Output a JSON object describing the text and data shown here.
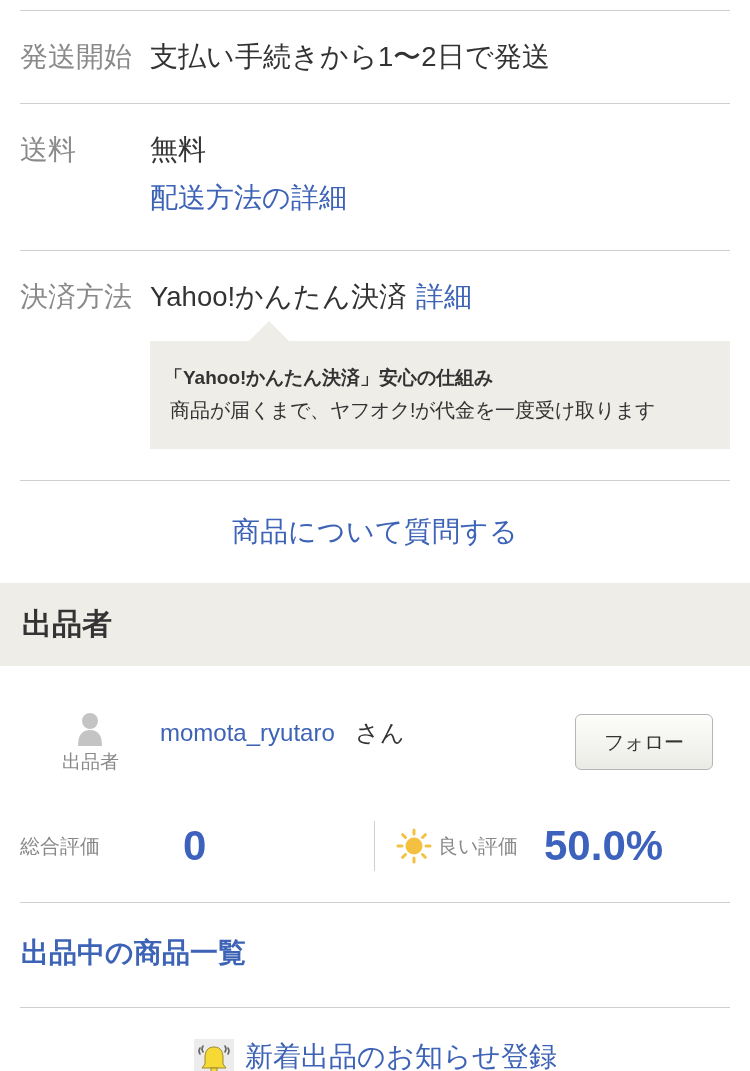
{
  "details": [
    {
      "kind": "plain",
      "label": "発送開始",
      "value": "支払い手続きから1〜2日で発送"
    },
    {
      "kind": "link_below",
      "label": "送料",
      "value": "無料",
      "link": "配送方法の詳細"
    },
    {
      "kind": "link_inline",
      "label": "決済方法",
      "value": "Yahoo!かんたん決済",
      "link": "詳細",
      "note": {
        "title": "「Yahoo!かんたん決済」安心の仕組み",
        "body": "商品が届くまで、ヤフオク!が代金を一度受け取ります"
      }
    }
  ],
  "question_link": "商品について質問する",
  "seller": {
    "heading": "出品者",
    "avatar_label": "出品者",
    "name": "momota_ryutaro",
    "honorific": "さん",
    "follow_button": "フォロー",
    "ratings": [
      {
        "kind": "total",
        "label": "総合評価",
        "value": "0"
      },
      {
        "kind": "good",
        "label": "良い評価",
        "value": "50.0%"
      }
    ]
  },
  "listing_link": "出品中の商品一覧",
  "alert_link": "新着出品のお知らせ登録"
}
